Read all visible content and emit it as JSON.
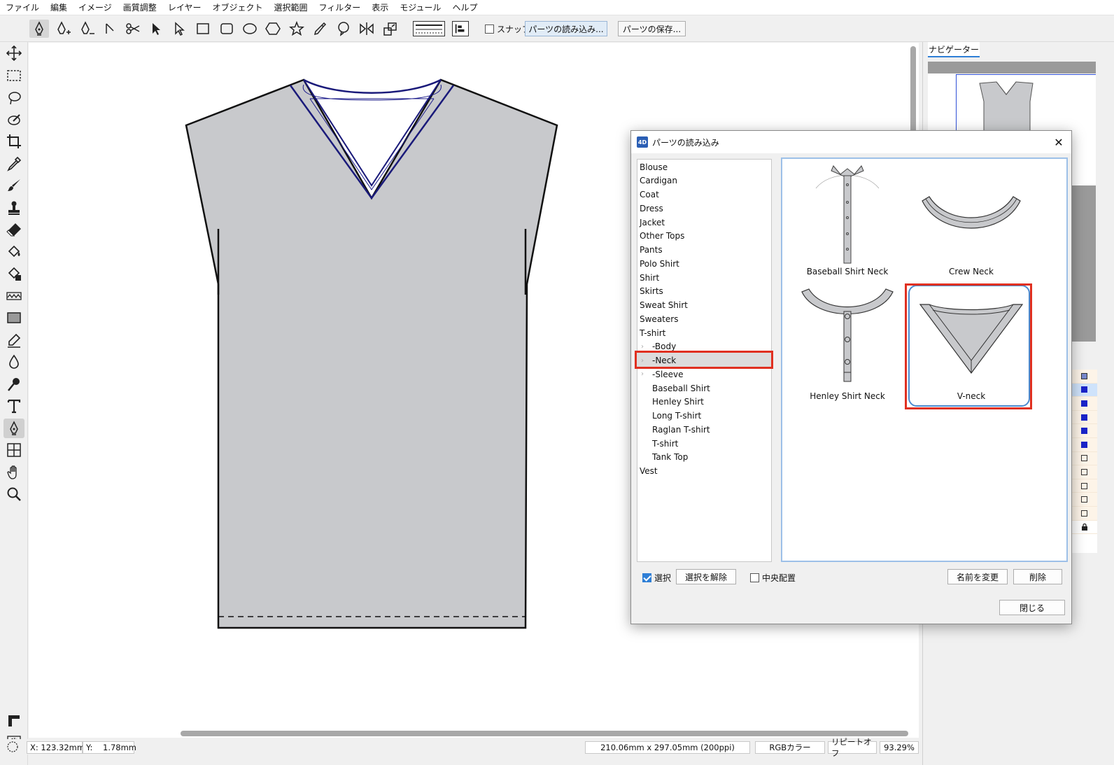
{
  "menu": [
    "ファイル",
    "編集",
    "イメージ",
    "画質調整",
    "レイヤー",
    "オブジェクト",
    "選択範囲",
    "フィルター",
    "表示",
    "モジュール",
    "ヘルプ"
  ],
  "toolbar": {
    "snap_label": "スナップ",
    "load_parts_label": "パーツの読み込み...",
    "save_parts_label": "パーツの保存..."
  },
  "navigator": {
    "tab_label": "ナビゲーター"
  },
  "status": {
    "x_label": "X:",
    "x_value": "123.32mm",
    "y_label": "Y:",
    "y_value": "1.78mm",
    "doc_size": "210.06mm x 297.05mm (200ppi)",
    "color_mode": "RGBカラー",
    "repeat": "リピートオフ",
    "zoom": "93.29%"
  },
  "dialog": {
    "title": "パーツの読み込み",
    "icon_text": "4D",
    "categories": [
      {
        "label": "Blouse",
        "sub": false
      },
      {
        "label": "Cardigan",
        "sub": false
      },
      {
        "label": "Coat",
        "sub": false
      },
      {
        "label": "Dress",
        "sub": false
      },
      {
        "label": "Jacket",
        "sub": false
      },
      {
        "label": "Other Tops",
        "sub": false
      },
      {
        "label": "Pants",
        "sub": false
      },
      {
        "label": "Polo Shirt",
        "sub": false
      },
      {
        "label": "Shirt",
        "sub": false
      },
      {
        "label": "Skirts",
        "sub": false
      },
      {
        "label": "Sweat Shirt",
        "sub": false
      },
      {
        "label": "Sweaters",
        "sub": false
      },
      {
        "label": "T-shirt",
        "sub": false
      },
      {
        "label": "-Body",
        "sub": true,
        "expandable": true
      },
      {
        "label": "-Neck",
        "sub": true,
        "expandable": true,
        "selected": true
      },
      {
        "label": "-Sleeve",
        "sub": true,
        "expandable": true
      },
      {
        "label": "Baseball Shirt",
        "sub": true
      },
      {
        "label": "Henley Shirt",
        "sub": true
      },
      {
        "label": "Long T-shirt",
        "sub": true
      },
      {
        "label": "Raglan T-shirt",
        "sub": true
      },
      {
        "label": "T-shirt",
        "sub": true
      },
      {
        "label": "Tank Top",
        "sub": true
      },
      {
        "label": "Vest",
        "sub": false
      }
    ],
    "parts": [
      {
        "label": "Baseball Shirt Neck"
      },
      {
        "label": "Crew Neck"
      },
      {
        "label": "Henley Shirt Neck"
      },
      {
        "label": "V-neck",
        "selected": true
      }
    ],
    "select_label": "選択",
    "deselect_label": "選択を解除",
    "center_label": "中央配置",
    "rename_label": "名前を変更",
    "delete_label": "削除",
    "close_label": "閉じる"
  },
  "colors": {
    "garment_fill": "#c8c9cc",
    "outline": "#111111",
    "neck_stroke": "#1a1a7a",
    "highlight": "#e03020",
    "accent": "#2f7fd6"
  }
}
